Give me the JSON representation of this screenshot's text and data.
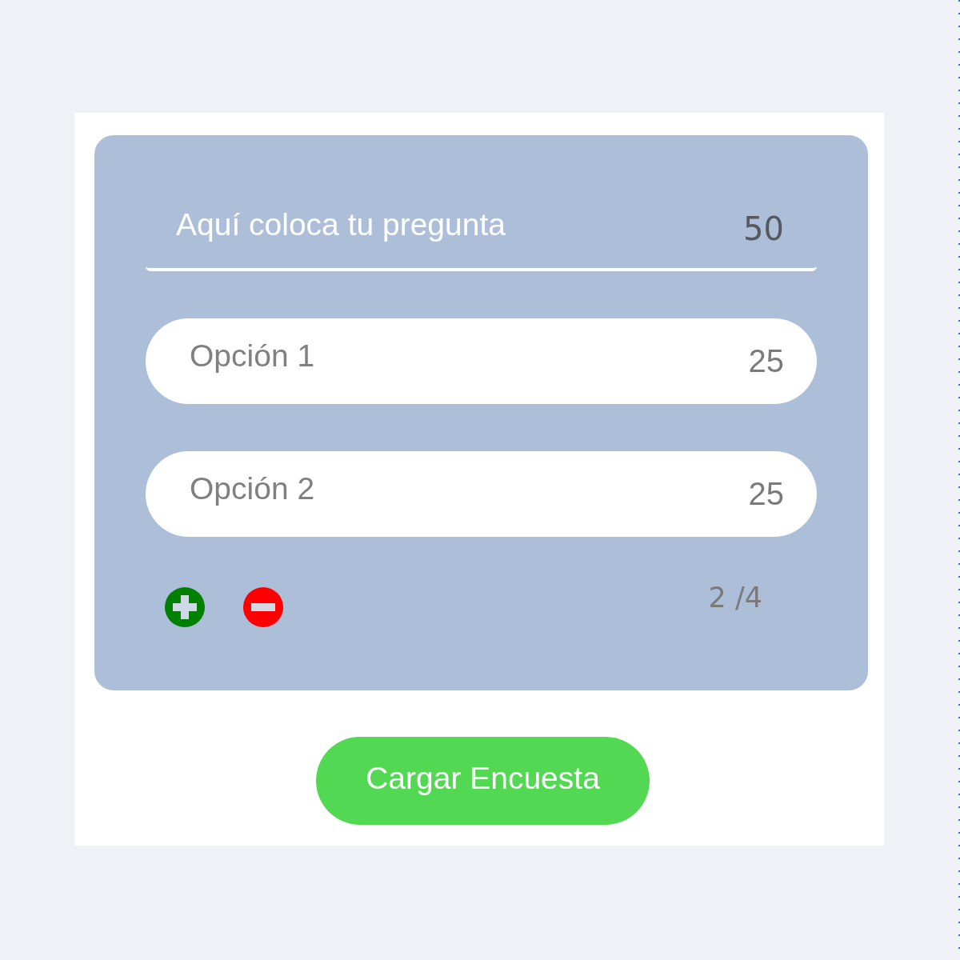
{
  "question": {
    "placeholder": "Aquí coloca tu pregunta",
    "counter": "50"
  },
  "options": [
    {
      "placeholder": "Opción 1",
      "counter": "25"
    },
    {
      "placeholder": "Opción 2",
      "counter": "25"
    }
  ],
  "option_controls": {
    "count": "2 /4"
  },
  "submit_button": {
    "label": "Cargar Encuesta"
  }
}
